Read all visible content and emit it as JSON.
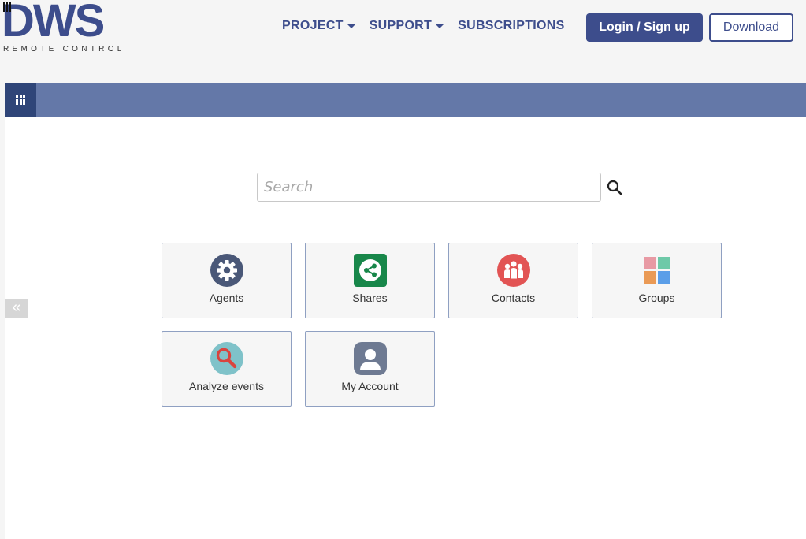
{
  "brand": {
    "logo_text": "DWS",
    "tagline": "REMOTE CONTROL"
  },
  "nav": {
    "items": [
      {
        "label": "PROJECT",
        "has_dropdown": true
      },
      {
        "label": "SUPPORT",
        "has_dropdown": true
      },
      {
        "label": "SUBSCRIPTIONS",
        "has_dropdown": false
      }
    ],
    "login_label": "Login / Sign up",
    "download_label": "Download"
  },
  "colors": {
    "brand": "#3d4d8c",
    "app_bar": "#6478a8",
    "app_bar_button": "#2f4578"
  },
  "search": {
    "placeholder": "Search",
    "value": ""
  },
  "tiles": [
    {
      "label": "Agents",
      "icon": "gear-icon"
    },
    {
      "label": "Shares",
      "icon": "share-icon"
    },
    {
      "label": "Contacts",
      "icon": "contacts-icon"
    },
    {
      "label": "Groups",
      "icon": "groups-icon"
    },
    {
      "label": "Analyze events",
      "icon": "magnifier-icon"
    },
    {
      "label": "My Account",
      "icon": "user-icon"
    }
  ],
  "sidebar_toggle": "«"
}
